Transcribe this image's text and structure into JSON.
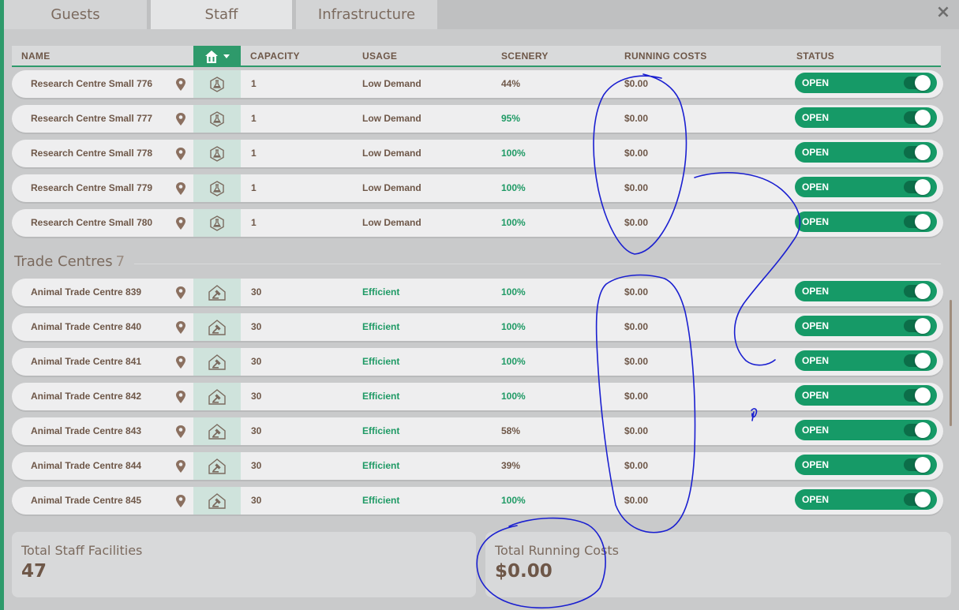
{
  "tabs": [
    {
      "label": "Guests",
      "active": false
    },
    {
      "label": "Staff",
      "active": true
    },
    {
      "label": "Infrastructure",
      "active": false
    }
  ],
  "close_icon": "×",
  "headers": {
    "name": "NAME",
    "type_filter_icon": "building-icon",
    "capacity": "CAPACITY",
    "usage": "USAGE",
    "scenery": "SCENERY",
    "running_costs": "RUNNING COSTS",
    "status": "STATUS"
  },
  "research_rows": [
    {
      "name": "Research Centre Small 776",
      "capacity": "1",
      "usage": "Low Demand",
      "scenery": "44%",
      "costs": "$0.00",
      "status": "OPEN"
    },
    {
      "name": "Research Centre Small 777",
      "capacity": "1",
      "usage": "Low Demand",
      "scenery": "95%",
      "costs": "$0.00",
      "status": "OPEN"
    },
    {
      "name": "Research Centre Small 778",
      "capacity": "1",
      "usage": "Low Demand",
      "scenery": "100%",
      "costs": "$0.00",
      "status": "OPEN"
    },
    {
      "name": "Research Centre Small 779",
      "capacity": "1",
      "usage": "Low Demand",
      "scenery": "100%",
      "costs": "$0.00",
      "status": "OPEN"
    },
    {
      "name": "Research Centre Small 780",
      "capacity": "1",
      "usage": "Low Demand",
      "scenery": "100%",
      "costs": "$0.00",
      "status": "OPEN"
    }
  ],
  "trade_section": {
    "title": "Trade Centres",
    "count": "7"
  },
  "trade_rows": [
    {
      "name": "Animal Trade Centre 839",
      "capacity": "30",
      "usage": "Efficient",
      "scenery": "100%",
      "costs": "$0.00",
      "status": "OPEN"
    },
    {
      "name": "Animal Trade Centre 840",
      "capacity": "30",
      "usage": "Efficient",
      "scenery": "100%",
      "costs": "$0.00",
      "status": "OPEN"
    },
    {
      "name": "Animal Trade Centre 841",
      "capacity": "30",
      "usage": "Efficient",
      "scenery": "100%",
      "costs": "$0.00",
      "status": "OPEN"
    },
    {
      "name": "Animal Trade Centre 842",
      "capacity": "30",
      "usage": "Efficient",
      "scenery": "100%",
      "costs": "$0.00",
      "status": "OPEN"
    },
    {
      "name": "Animal Trade Centre 843",
      "capacity": "30",
      "usage": "Efficient",
      "scenery": "58%",
      "costs": "$0.00",
      "status": "OPEN"
    },
    {
      "name": "Animal Trade Centre 844",
      "capacity": "30",
      "usage": "Efficient",
      "scenery": "39%",
      "costs": "$0.00",
      "status": "OPEN"
    },
    {
      "name": "Animal Trade Centre 845",
      "capacity": "30",
      "usage": "Efficient",
      "scenery": "100%",
      "costs": "$0.00",
      "status": "OPEN"
    }
  ],
  "totals": {
    "staff_label": "Total Staff Facilities",
    "staff_value": "47",
    "costs_label": "Total Running Costs",
    "costs_value": "$0.00"
  },
  "colors": {
    "accent_green": "#169a67",
    "good_text": "#1f9a65",
    "brown_text": "#6e5748",
    "annotation_ink": "#1a1fd0"
  }
}
